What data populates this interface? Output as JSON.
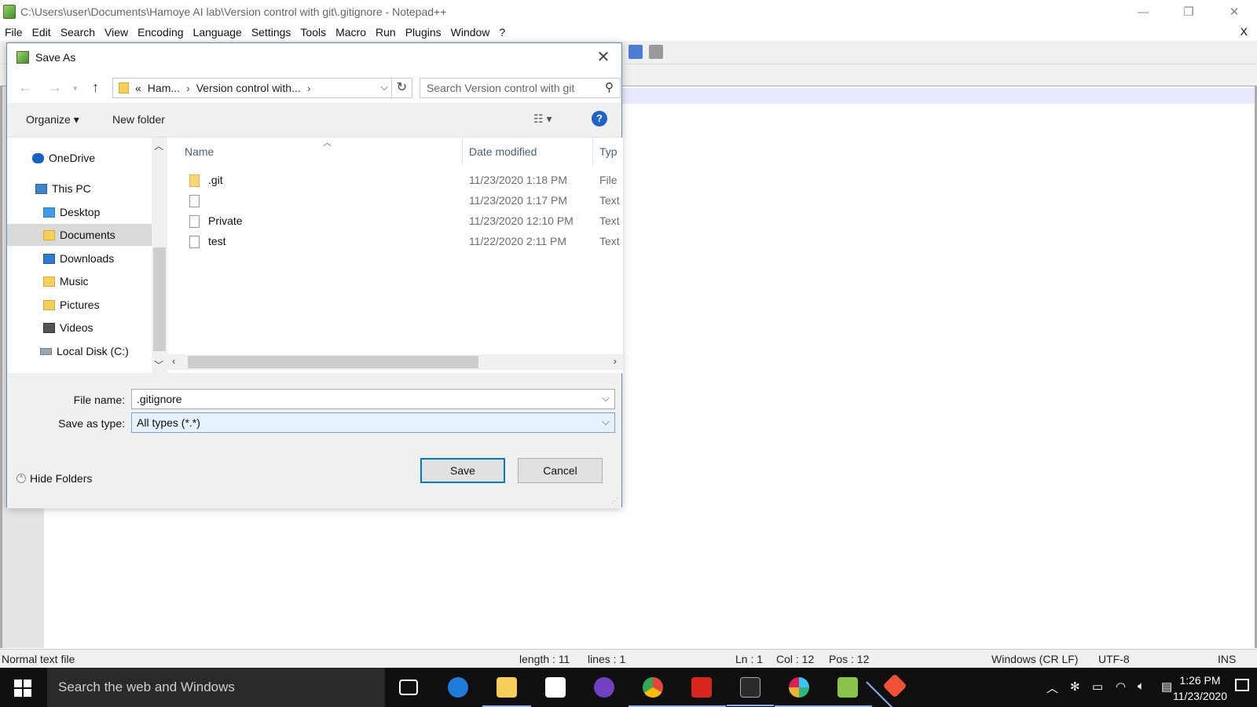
{
  "window": {
    "title": "C:\\Users\\user\\Documents\\Hamoye AI lab\\Version control with git\\.gitignore - Notepad++",
    "minimize": "—",
    "maximize": "❐",
    "close": "✕"
  },
  "menu": [
    "File",
    "Edit",
    "Search",
    "View",
    "Encoding",
    "Language",
    "Settings",
    "Tools",
    "Macro",
    "Run",
    "Plugins",
    "Window",
    "?"
  ],
  "menu_close": "X",
  "status_bar": {
    "file_type": "Normal text file",
    "length": "length : 11",
    "lines": "lines : 1",
    "ln": "Ln : 1",
    "col": "Col : 12",
    "pos": "Pos : 12",
    "eol": "Windows (CR LF)",
    "encoding": "UTF-8",
    "mode": "INS"
  },
  "dialog": {
    "title": "Save As",
    "close": "✕",
    "address": {
      "prefix": "«",
      "segment1": "Ham...",
      "segment2": "Version control with...",
      "arrow": "›"
    },
    "search_placeholder": "Search Version control with git",
    "toolbar": {
      "organize": "Organize ▾",
      "new_folder": "New folder",
      "help": "?"
    },
    "nav_items": [
      {
        "label": "OneDrive",
        "icon": "cloud-icon",
        "color": "#1a62c5"
      },
      {
        "label": "This PC",
        "icon": "computer-icon",
        "color": "#3f83d0"
      },
      {
        "label": "Desktop",
        "icon": "desktop-folder-icon",
        "color": "#3d9be9"
      },
      {
        "label": "Documents",
        "icon": "documents-folder-icon",
        "color": "#f6cf5a"
      },
      {
        "label": "Downloads",
        "icon": "downloads-folder-icon",
        "color": "#2f7ad1"
      },
      {
        "label": "Music",
        "icon": "music-folder-icon",
        "color": "#f6cf5a"
      },
      {
        "label": "Pictures",
        "icon": "pictures-folder-icon",
        "color": "#f6cf5a"
      },
      {
        "label": "Videos",
        "icon": "videos-folder-icon",
        "color": "#555555"
      },
      {
        "label": "Local Disk (C:)",
        "icon": "drive-icon",
        "color": "#9aa6b4"
      }
    ],
    "selected_nav": "Documents",
    "columns": {
      "name": "Name",
      "date": "Date modified",
      "type": "Typ"
    },
    "files": [
      {
        "name": ".git",
        "date": "11/23/2020 1:18 PM",
        "type": "File",
        "kind": "folder"
      },
      {
        "name": "",
        "date": "11/23/2020 1:17 PM",
        "type": "Text",
        "kind": "doc"
      },
      {
        "name": "Private",
        "date": "11/23/2020 12:10 PM",
        "type": "Text",
        "kind": "doc"
      },
      {
        "name": "test",
        "date": "11/22/2020 2:11 PM",
        "type": "Text",
        "kind": "doc"
      }
    ],
    "file_name_label": "File name:",
    "file_name_value": ".gitignore",
    "save_type_label": "Save as type:",
    "save_type_value": "All types (*.*)",
    "hide_folders": "Hide Folders",
    "save_button": "Save",
    "cancel_button": "Cancel"
  },
  "taskbar": {
    "search_text": "Search the web and Windows",
    "time": "1:26 PM",
    "date": "11/23/2020",
    "apps": [
      {
        "name": "task-view-icon",
        "color": "#ffffff"
      },
      {
        "name": "edge-icon",
        "color": "#1e7bd8"
      },
      {
        "name": "file-explorer-icon",
        "color": "#f6cf5a"
      },
      {
        "name": "store-icon",
        "color": "#ffffff"
      },
      {
        "name": "github-desktop-icon",
        "color": "#6f42c1"
      },
      {
        "name": "chrome-icon",
        "color": "#e8453c"
      },
      {
        "name": "acrobat-icon",
        "color": "#d7261e"
      },
      {
        "name": "terminal-icon",
        "color": "#2b2b2b"
      },
      {
        "name": "slack-icon",
        "color": "#ecb22e"
      },
      {
        "name": "notepad-plus-plus-icon",
        "color": "#8bc34a"
      },
      {
        "name": "git-gui-icon",
        "color": "#f05033"
      }
    ]
  }
}
